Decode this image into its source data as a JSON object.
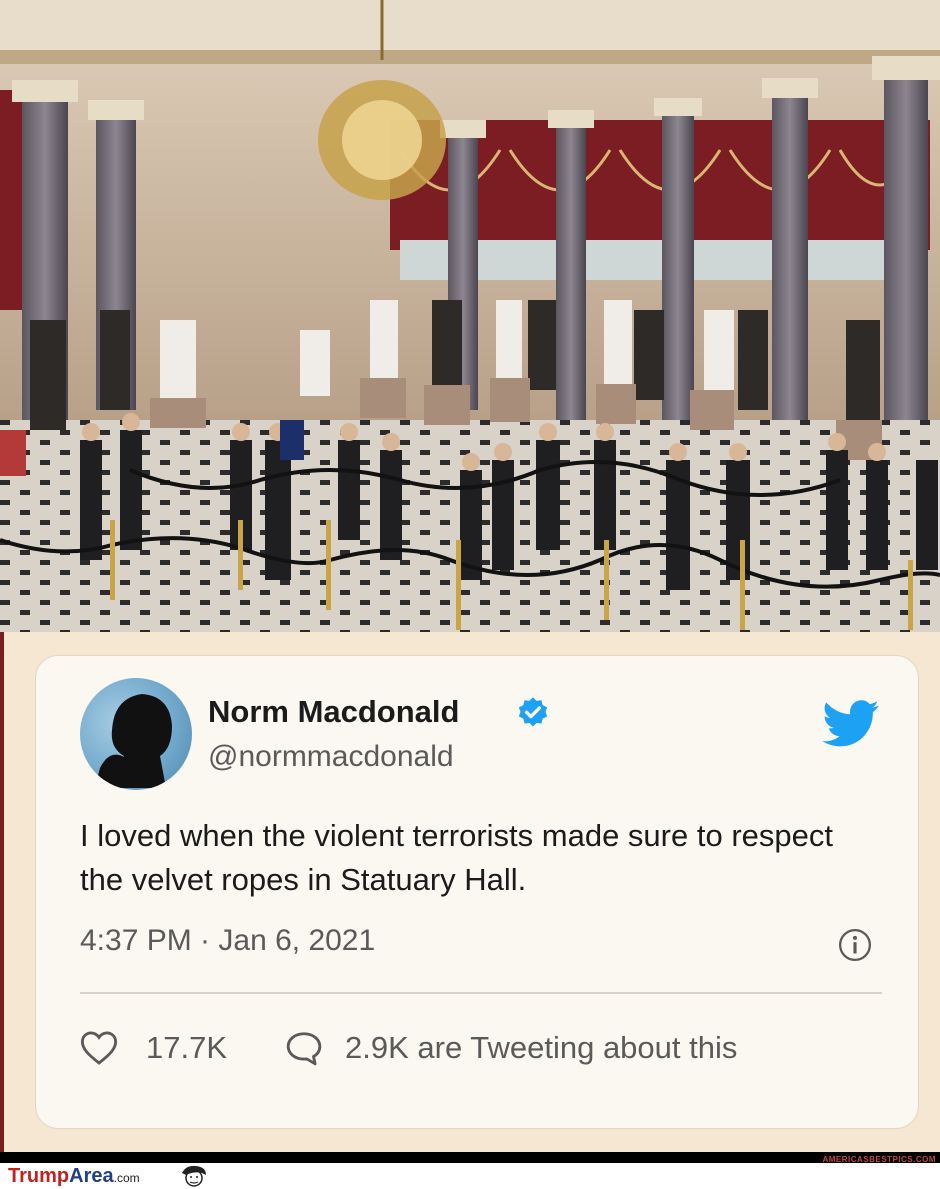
{
  "tweet": {
    "display_name": "Norm Macdonald",
    "handle": "@normmacdonald",
    "text": "I loved when the violent terrorists made sure to respect the velvet ropes in Statuary Hall.",
    "timestamp": "4:37 PM · Jan 6, 2021",
    "likes": "17.7K",
    "replies_text": "2.9K are Tweeting about this"
  },
  "footer": {
    "site_text": "AMERICASBESTPICS.COM"
  },
  "watermark": {
    "brand_trump": "Trump",
    "brand_area": "Area",
    "brand_suffix": ".com"
  },
  "colors": {
    "twitter_blue": "#1da1f2",
    "panel_bg": "#f6e7d3",
    "card_bg": "#fbf7f1",
    "brand_red": "#c42020",
    "brand_blue": "#1f3f8a"
  },
  "icons": [
    "chandelier-icon",
    "verified-badge-icon",
    "twitter-bird-icon",
    "info-icon",
    "heart-icon",
    "reply-icon",
    "face-caricature-icon"
  ]
}
